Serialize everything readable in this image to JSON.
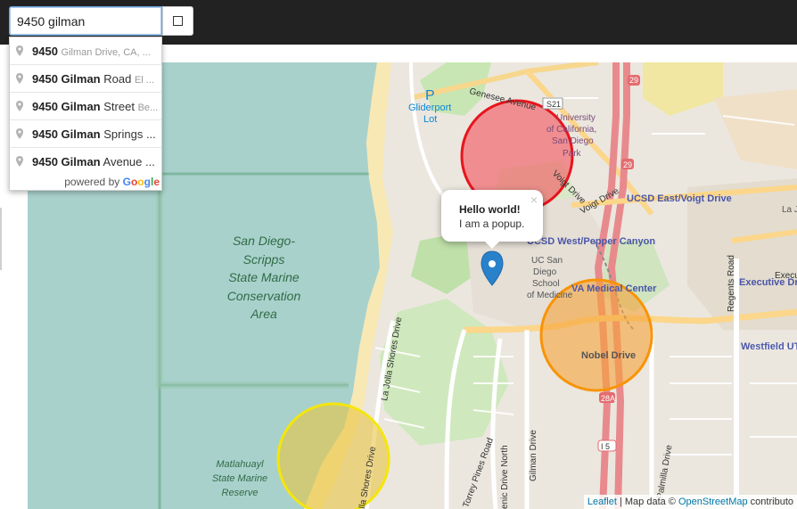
{
  "search": {
    "value": "9450 gilman",
    "button_icon": "square-icon"
  },
  "suggestions": [
    {
      "number": "9450",
      "street": "Gilman",
      "suffix": "",
      "secondary": "Gilman Drive, CA, ..."
    },
    {
      "number": "9450",
      "street": "Gilman",
      "suffix": "Road",
      "secondary": "El ..."
    },
    {
      "number": "9450",
      "street": "Gilman",
      "suffix": "Street",
      "secondary": "Be..."
    },
    {
      "number": "9450",
      "street": "Gilman",
      "suffix": "Springs ...",
      "secondary": ""
    },
    {
      "number": "9450",
      "street": "Gilman",
      "suffix": "Avenue ...",
      "secondary": ""
    }
  ],
  "powered_by": {
    "text": "powered by",
    "logo": [
      "G",
      "o",
      "o",
      "g",
      "l",
      "e"
    ]
  },
  "popup": {
    "title": "Hello world!",
    "body": "I am a popup.",
    "close": "×"
  },
  "attribution": {
    "leaflet": "Leaflet",
    "sep": " | Map data © ",
    "osm": "OpenStreetMap",
    "rest": " contributo"
  },
  "map_labels": {
    "genesee": "Genesee Avenue",
    "s21": "S21",
    "parking": "P",
    "gliderport1": "Gliderport",
    "gliderport2": "Lot",
    "ucsd1": "University",
    "ucsd2": "of California,",
    "ucsd3": "San Diego",
    "ucsd4": "Park",
    "voigt1": "Voigt Drive",
    "voigt2": "UCSD East/Voigt Drive",
    "pepper": "UCSD West/Pepper Canyon",
    "med1": "UC San",
    "med2": "Diego",
    "med3": "School",
    "med4": "of Medicine",
    "va": "VA Medical Center",
    "nobel": "Nobel Drive",
    "hw29a": "29",
    "hw29b": "29",
    "hw28a": "28A",
    "i5": "I 5",
    "regents": "Regents Road",
    "executive": "Executive Dri",
    "exec2": "Executive Dr",
    "westfield": "Westfield UT",
    "la_jolla_shores": "La Jolla Shores Drive",
    "la_jolla_shores2": "lla Shores Drive",
    "gilman": "Gilman Drive",
    "torrey": "Torrey Pines Road",
    "scenic": "enic Drive North",
    "palmilla": "Palmilla Drive",
    "la_jolla_right": "La Jo",
    "ocean1": "San Diego-",
    "ocean2": "Scripps",
    "ocean3": "State Marine",
    "ocean4": "Conservation",
    "ocean5": "Area",
    "matl1": "Matlahuayl",
    "matl2": "State Marine",
    "matl3": "Reserve"
  },
  "circles": [
    {
      "name": "red",
      "color": "#e8141c",
      "fill": "#f3525c"
    },
    {
      "name": "orange",
      "color": "#f89406",
      "fill": "#f5a33b"
    },
    {
      "name": "yellow",
      "color": "#f5e60a",
      "fill": "#e8c443"
    }
  ]
}
